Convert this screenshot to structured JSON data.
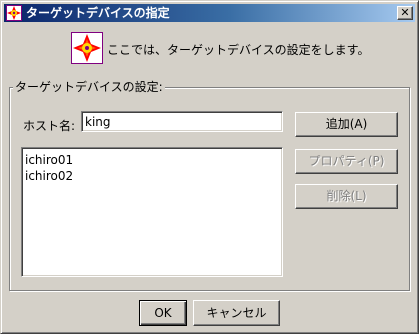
{
  "window": {
    "title": "ターゲットデバイスの指定",
    "close_label": "✕"
  },
  "header": {
    "description": "ここでは、ターゲットデバイスの設定をします。"
  },
  "group": {
    "legend": "ターゲットデバイスの設定:"
  },
  "host": {
    "label": "ホスト名:",
    "value": "king"
  },
  "device_list": {
    "items": [
      "ichiro01",
      "ichiro02"
    ]
  },
  "buttons": {
    "add": "追加(A)",
    "properties": "プロパティ(P)",
    "delete": "削除(L)",
    "ok": "OK",
    "cancel": "キャンセル"
  },
  "colors": {
    "title_bar_start": "#0a246a",
    "title_bar_end": "#a6caf0",
    "face": "#d4d0c8"
  },
  "icons": {
    "title": "target-device-icon",
    "header": "target-device-icon"
  }
}
